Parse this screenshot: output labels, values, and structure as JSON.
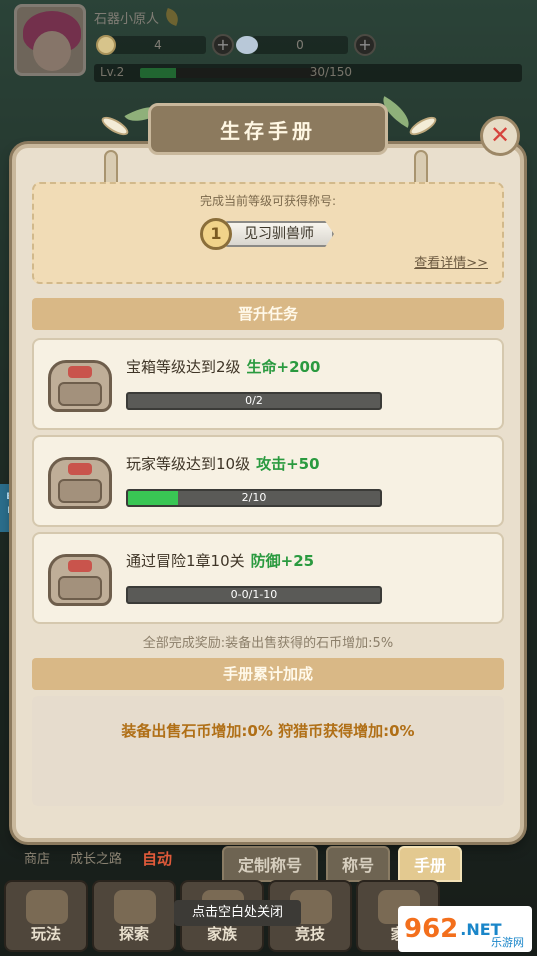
{
  "player": {
    "name": "石器小原人",
    "coins": "4",
    "gems": "0",
    "level_label": "Lv.2",
    "xp": "30/150",
    "xp_fraction": 0.2
  },
  "modal": {
    "title": "生存手册",
    "title_hint": "完成当前等级可获得称号:",
    "rank_number": "1",
    "rank_title": "见习驯兽师",
    "details_link": "查看详情>>",
    "promotion_section": "晋升任务",
    "tasks": [
      {
        "text": "宝箱等级达到2级",
        "reward": "生命+200",
        "progress": "0/2",
        "fraction": 0
      },
      {
        "text": "玩家等级达到10级",
        "reward": "攻击+50",
        "progress": "2/10",
        "fraction": 0.2
      },
      {
        "text": "通过冒险1章10关",
        "reward": "防御+25",
        "progress": "0-0/1-10",
        "fraction": 0
      }
    ],
    "all_complete_bonus": "全部完成奖励:装备出售获得的石币增加:5%",
    "accumulated_section": "手册累计加成",
    "accumulated_text": "装备出售石币增加:0%  狩猎币获得增加:0%"
  },
  "tabs": [
    "定制称号",
    "称号",
    "手册"
  ],
  "background_labels": {
    "shop": "商店",
    "growth": "成长之路",
    "auto": "自动"
  },
  "close_hint": "点击空白处关闭",
  "nav": [
    "玩法",
    "探索",
    "家族",
    "竞技",
    "家"
  ],
  "watermark": {
    "brand": "962",
    "net": ".NET",
    "sub": "乐游网"
  },
  "side_badge": "BUG RAY",
  "colors": {
    "accent_green": "#2a9a3f",
    "progress_green": "#39c654",
    "bonus_orange": "#b06f16",
    "close_red": "#d6443d"
  }
}
